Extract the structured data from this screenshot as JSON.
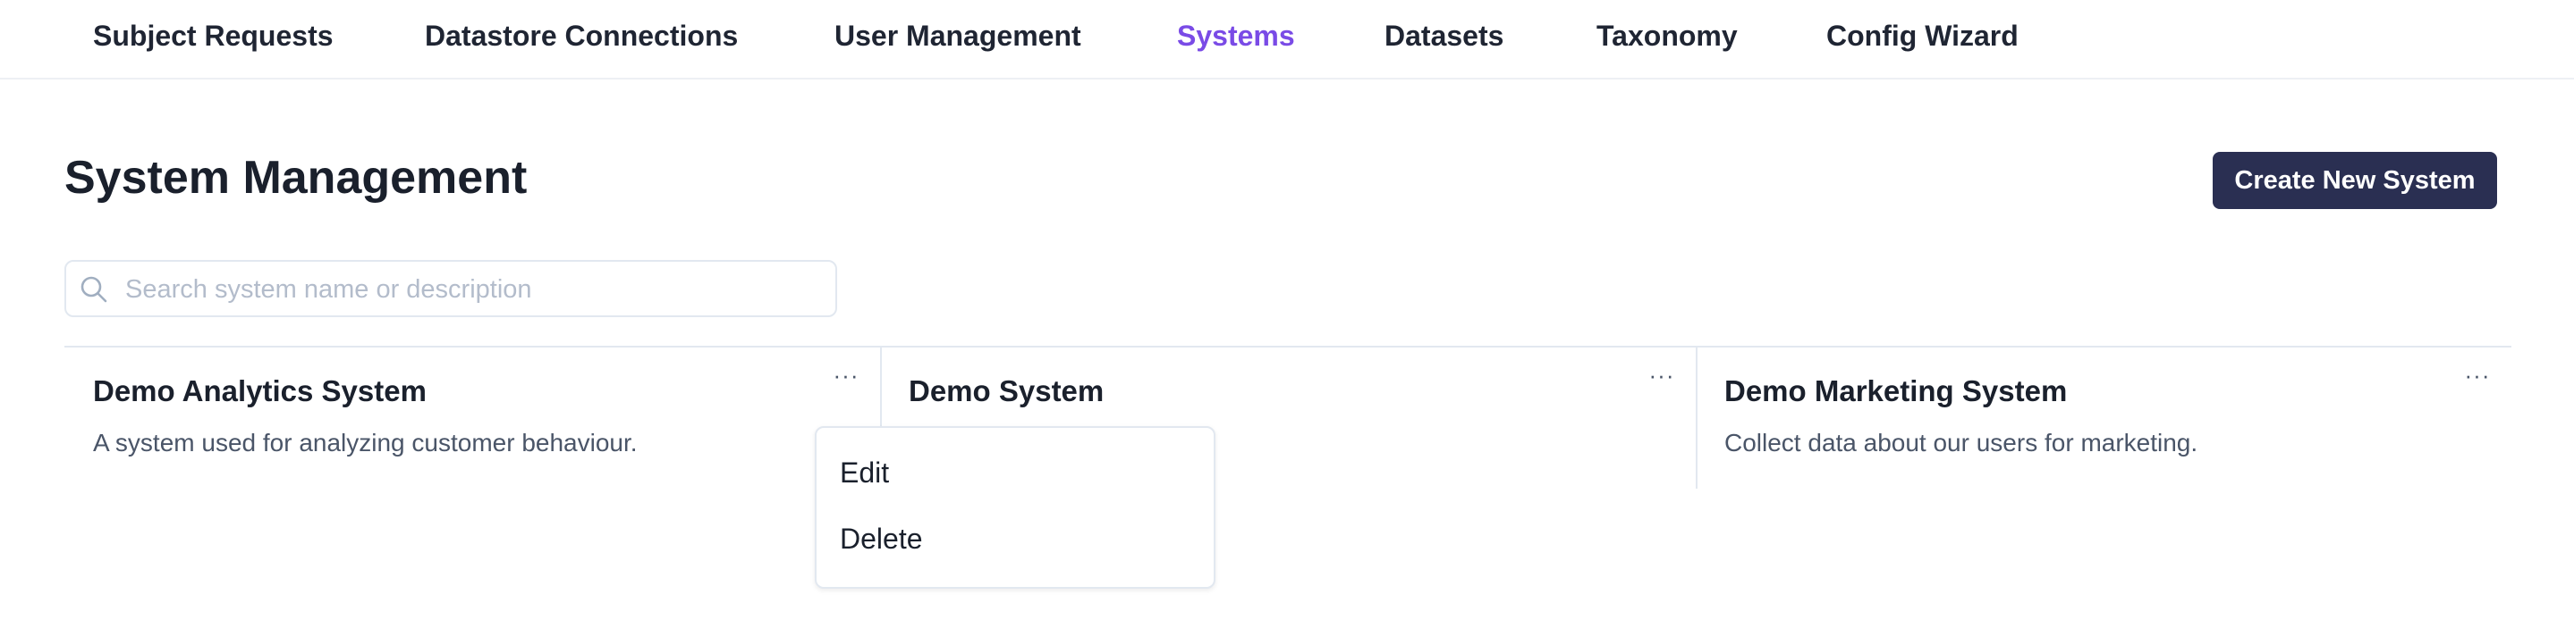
{
  "nav": {
    "items": [
      {
        "label": "Subject Requests"
      },
      {
        "label": "Datastore Connections"
      },
      {
        "label": "User Management"
      },
      {
        "label": "Systems",
        "active": true
      },
      {
        "label": "Datasets"
      },
      {
        "label": "Taxonomy"
      },
      {
        "label": "Config Wizard"
      }
    ]
  },
  "header": {
    "title": "System Management",
    "create_button": "Create New System"
  },
  "search": {
    "placeholder": "Search system name or description",
    "value": "",
    "icon": "search-icon"
  },
  "systems": [
    {
      "name": "Demo Analytics System",
      "description": "A system used for analyzing customer behaviour.",
      "more": "···"
    },
    {
      "name": "Demo System",
      "description": "",
      "more": "···"
    },
    {
      "name": "Demo Marketing System",
      "description": "Collect data about our users for marketing.",
      "more": "···"
    }
  ],
  "context_menu": {
    "edit": "Edit",
    "delete": "Delete"
  },
  "colors": {
    "accent": "#7a4be6",
    "primary_button": "#2a2f52",
    "border": "#e2e8f0"
  }
}
